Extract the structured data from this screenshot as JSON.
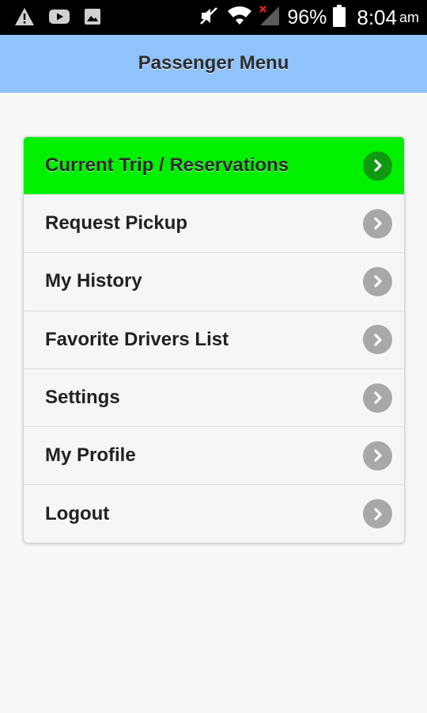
{
  "status_bar": {
    "left_icons": [
      "warning-icon",
      "youtube-icon",
      "image-icon"
    ],
    "right_icons": [
      "mute-icon",
      "wifi-icon",
      "signal-icon",
      "battery-icon"
    ],
    "battery": "96%",
    "time": "8:04",
    "ampm": "am"
  },
  "header": {
    "title": "Passenger Menu",
    "color": "#90c3fb"
  },
  "menu": {
    "items": [
      {
        "label": "Current Trip / Reservations",
        "active": true
      },
      {
        "label": "Request Pickup"
      },
      {
        "label": "My History"
      },
      {
        "label": "Favorite Drivers List"
      },
      {
        "label": "Settings"
      },
      {
        "label": "My Profile"
      },
      {
        "label": "Logout"
      }
    ],
    "active_color": "#00f000",
    "chevron_icon": "chevron-right-icon"
  }
}
